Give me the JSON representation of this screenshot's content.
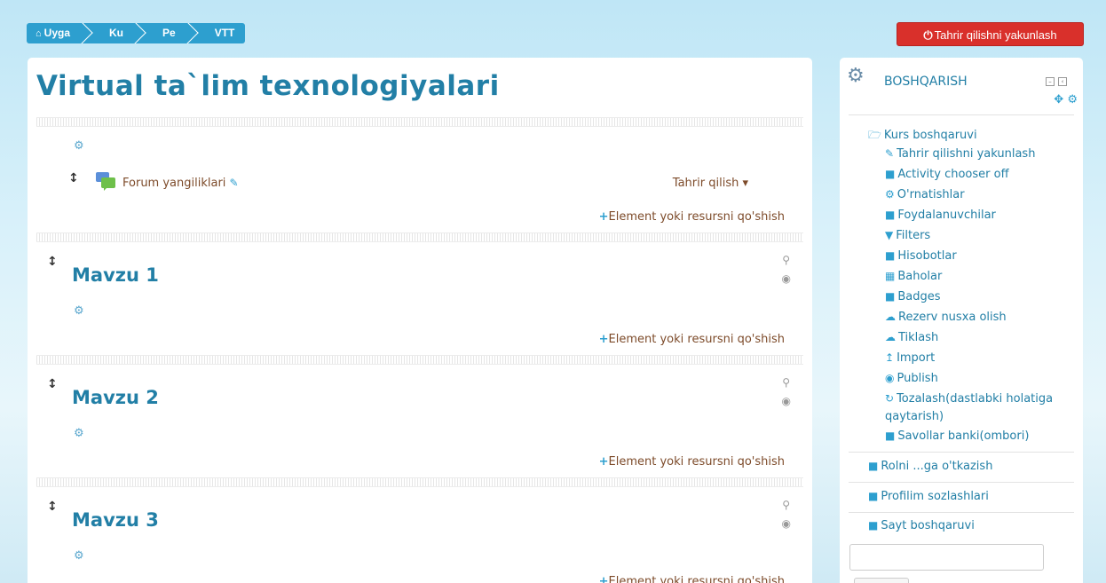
{
  "breadcrumb": {
    "items": [
      "Uyga",
      "Ku",
      "Pe",
      "VTT"
    ]
  },
  "header": {
    "edit_off_label": "Tahrir qilishni yakunlash"
  },
  "course": {
    "title": "Virtual ta`lim texnologiyalari",
    "forum_link": "Forum yangiliklari",
    "edit_menu": "Tahrir qilish",
    "add_label": "Element yoki resursni qo'shish",
    "sections": [
      "Mavzu 1",
      "Mavzu 2",
      "Mavzu 3"
    ]
  },
  "sidebar": {
    "title": "BOSHQARISH",
    "course_admin": "Kurs boshqaruvi",
    "items": [
      {
        "label": "Tahrir qilishni yakunlash",
        "icon": "pencil-icon"
      },
      {
        "label": "Activity chooser off",
        "icon": "file-icon"
      },
      {
        "label": "O'rnatishlar",
        "icon": "cogs-icon"
      },
      {
        "label": "Foydalanuvchilar",
        "icon": "folder-icon"
      },
      {
        "label": "Filters",
        "icon": "filter-icon"
      },
      {
        "label": "Hisobotlar",
        "icon": "folder-icon"
      },
      {
        "label": "Baholar",
        "icon": "table-icon"
      },
      {
        "label": "Badges",
        "icon": "folder-icon"
      },
      {
        "label": "Rezerv nusxa olish",
        "icon": "cloud-upload-icon"
      },
      {
        "label": "Tiklash",
        "icon": "cloud-download-icon"
      },
      {
        "label": "Import",
        "icon": "upload-icon"
      },
      {
        "label": "Publish",
        "icon": "globe-icon"
      },
      {
        "label": "Tozalash(dastlabki holatiga",
        "icon": "refresh-icon"
      },
      {
        "label": "qaytarish)",
        "icon": ""
      },
      {
        "label": "Savollar banki(ombori)",
        "icon": "folder-icon"
      }
    ],
    "role_switch": "Rolni ...ga o'tkazish",
    "profile": "Profilim sozlashlari",
    "site_admin": "Sayt boshqaruvi"
  }
}
